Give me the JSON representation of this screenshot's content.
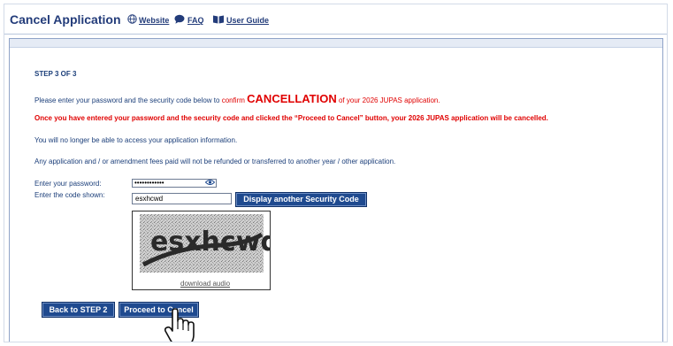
{
  "header": {
    "title": "Cancel Application",
    "links": {
      "website": "Website",
      "faq": "FAQ",
      "user_guide": "User Guide"
    }
  },
  "content": {
    "step": "STEP 3 OF 3",
    "intro_prefix": "Please enter your password and the security code below to",
    "intro_confirm": "confirm",
    "intro_cancellation": "CANCELLATION",
    "intro_suffix": "of your 2026 JUPAS application.",
    "warning": "Once you have entered your password and the security code and clicked the “Proceed to Cancel” button, your 2026 JUPAS application will be cancelled.",
    "no_access": "You will no longer be able to access your application information.",
    "fees": "Any application and / or amendment fees paid will not be refunded or transferred to another year / other application."
  },
  "form": {
    "password_label": "Enter your password:",
    "password_value": "••••••••••••",
    "code_label": "Enter the code shown:",
    "code_value": "esxhcwd",
    "another_code_button": "Display another Security Code",
    "captcha_text": "esxhcwd",
    "download_audio": "download audio"
  },
  "buttons": {
    "back": "Back to STEP 2",
    "proceed": "Proceed to Cancel"
  },
  "colors": {
    "brand": "#1f4a8f",
    "warning": "#e00000",
    "text": "#1c3f7a"
  }
}
